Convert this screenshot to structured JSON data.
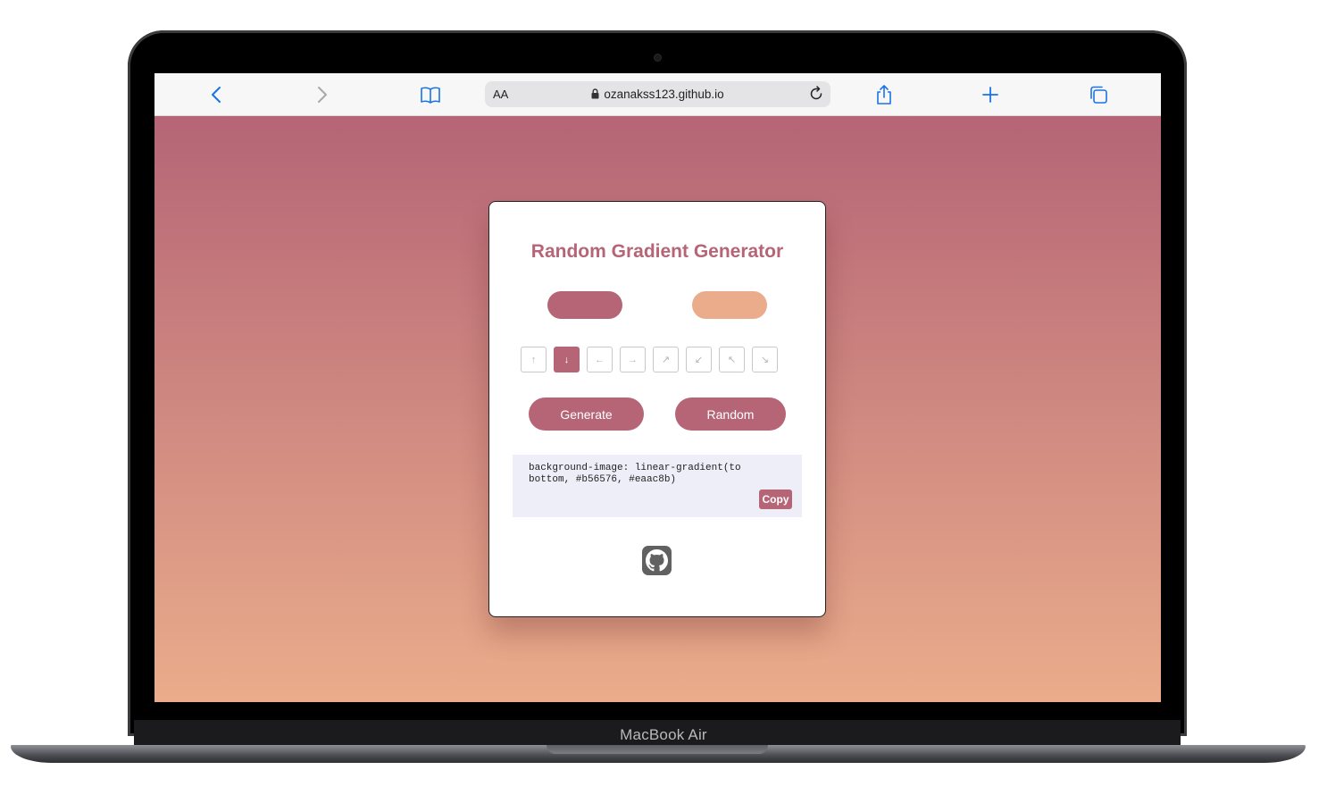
{
  "device": {
    "model_label": "MacBook Air"
  },
  "browser": {
    "text_size_label": "AA",
    "url": "ozanakss123.github.io",
    "back_icon": "chevron-left-icon",
    "forward_icon": "chevron-right-icon",
    "bookmarks_icon": "book-icon",
    "reload_icon": "reload-icon",
    "share_icon": "share-icon",
    "new_tab_icon": "plus-icon",
    "tabs_icon": "tabs-icon",
    "accent_color": "#1a73e8"
  },
  "app": {
    "title": "Random Gradient Generator",
    "color_1": "#b56576",
    "color_2": "#eaac8b",
    "directions": [
      {
        "icon": "arrow-up-icon",
        "glyph": "↑",
        "active": false
      },
      {
        "icon": "arrow-down-icon",
        "glyph": "↓",
        "active": true
      },
      {
        "icon": "arrow-left-icon",
        "glyph": "←",
        "active": false
      },
      {
        "icon": "arrow-right-icon",
        "glyph": "→",
        "active": false
      },
      {
        "icon": "arrow-up-right-icon",
        "glyph": "↗",
        "active": false
      },
      {
        "icon": "arrow-down-left-icon",
        "glyph": "↙",
        "active": false
      },
      {
        "icon": "arrow-up-left-icon",
        "glyph": "↖",
        "active": false
      },
      {
        "icon": "arrow-down-right-icon",
        "glyph": "↘",
        "active": false
      }
    ],
    "generate_label": "Generate",
    "random_label": "Random",
    "css_output": "background-image: linear-gradient(to bottom, #b56576, #eaac8b)",
    "copy_label": "Copy",
    "github_icon": "github-icon"
  }
}
